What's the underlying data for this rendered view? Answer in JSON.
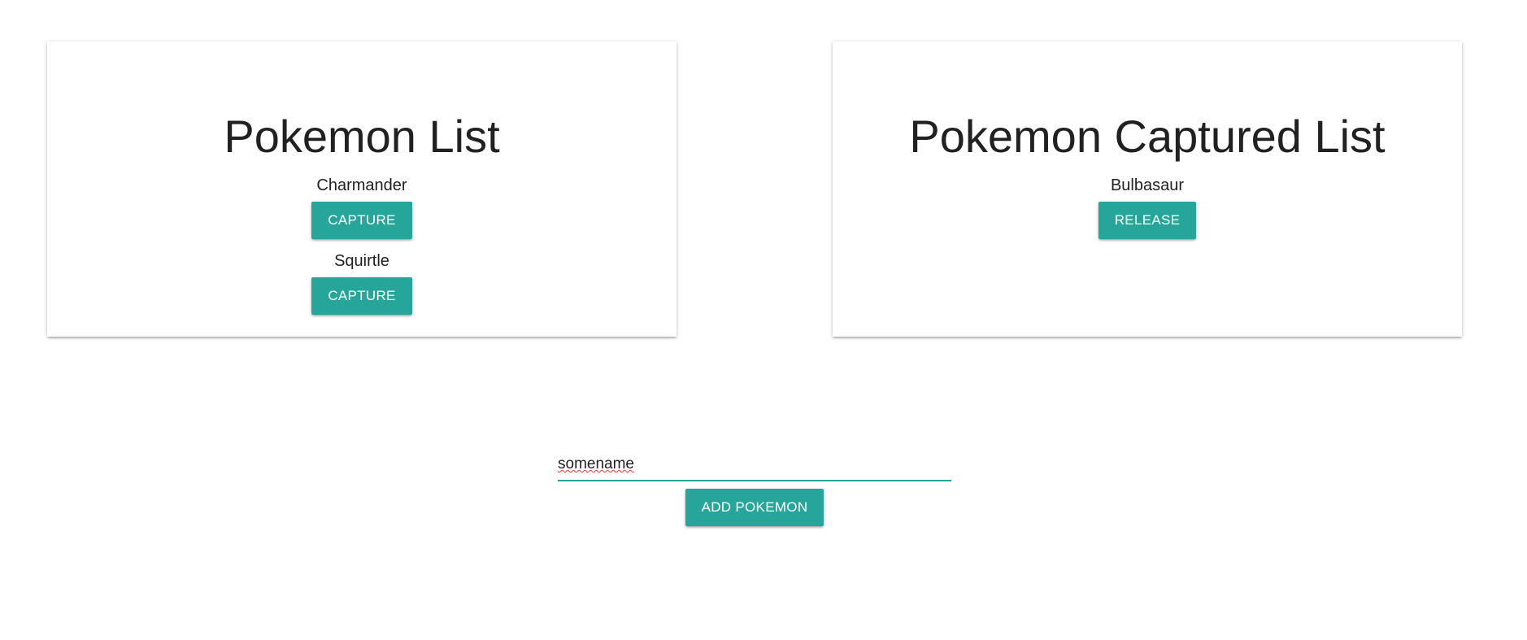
{
  "pokemon_list": {
    "title": "Pokemon List",
    "items": [
      {
        "name": "Charmander",
        "action_label": "CAPTURE"
      },
      {
        "name": "Squirtle",
        "action_label": "CAPTURE"
      }
    ]
  },
  "captured_list": {
    "title": "Pokemon Captured List",
    "items": [
      {
        "name": "Bulbasaur",
        "action_label": "RELEASE"
      }
    ]
  },
  "add_form": {
    "input_value": "somename",
    "button_label": "ADD POKEMON"
  },
  "colors": {
    "accent": "#26a69a",
    "text": "#212121",
    "background": "#ffffff"
  }
}
